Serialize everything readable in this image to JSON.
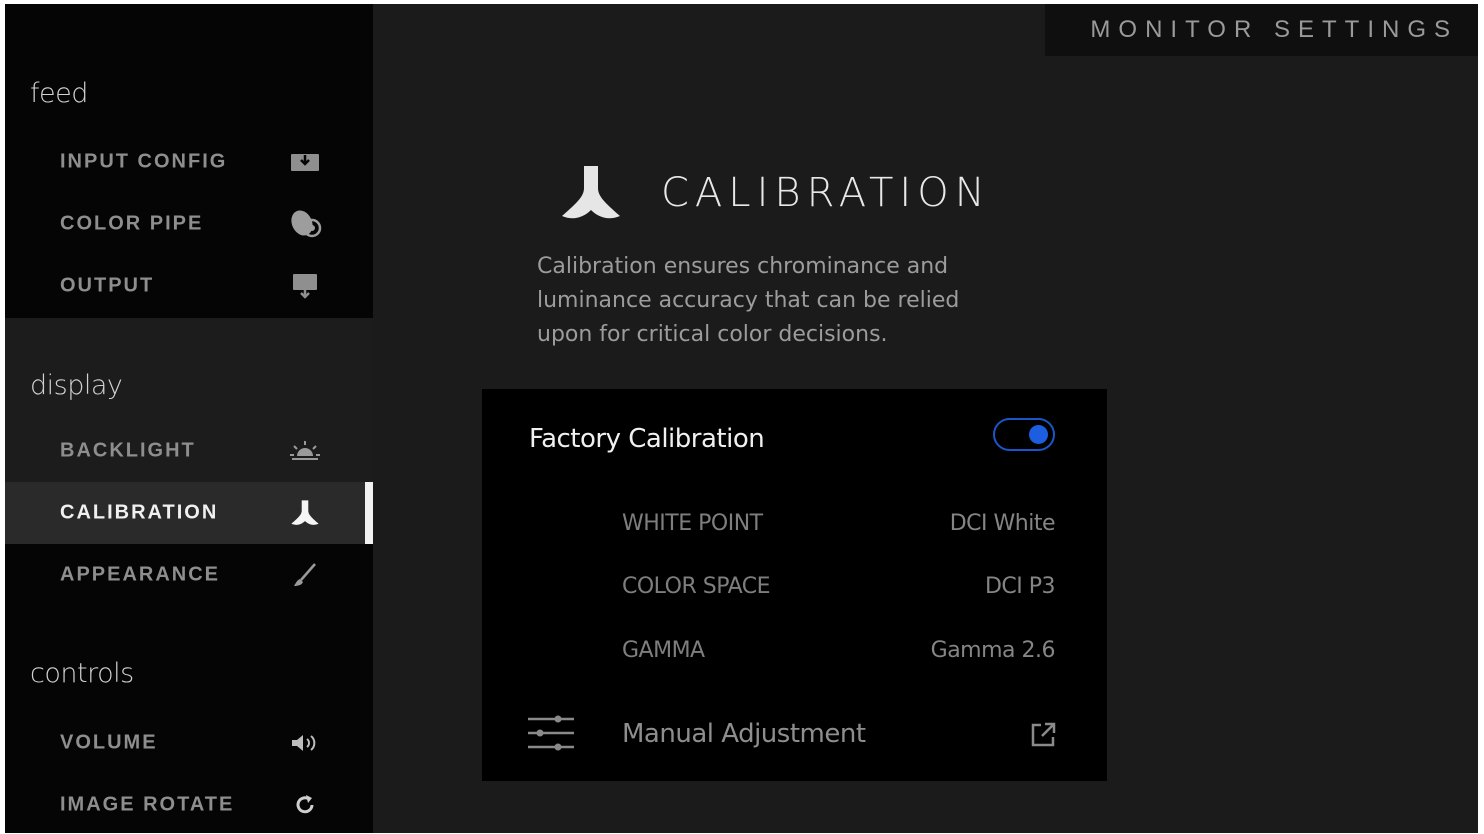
{
  "header": {
    "title": "MONITOR SETTINGS"
  },
  "sidebar": {
    "groups": [
      {
        "label": "feed",
        "items": [
          {
            "label": "INPUT CONFIG",
            "icon": "input-icon"
          },
          {
            "label": "COLOR PIPE",
            "icon": "color-pipe-icon"
          },
          {
            "label": "OUTPUT",
            "icon": "output-icon"
          }
        ]
      },
      {
        "label": "display",
        "items": [
          {
            "label": "BACKLIGHT",
            "icon": "backlight-icon"
          },
          {
            "label": "CALIBRATION",
            "icon": "calibration-icon",
            "active": true
          },
          {
            "label": "APPEARANCE",
            "icon": "brush-icon"
          }
        ]
      },
      {
        "label": "controls",
        "items": [
          {
            "label": "VOLUME",
            "icon": "volume-icon"
          },
          {
            "label": "IMAGE ROTATE",
            "icon": "rotate-icon"
          }
        ]
      }
    ]
  },
  "main": {
    "title": "CALIBRATION",
    "description": "Calibration ensures chrominance and luminance accuracy that can be relied upon for critical color decisions.",
    "panel": {
      "factory_calibration_label": "Factory Calibration",
      "factory_calibration_on": true,
      "rows": [
        {
          "label": "WHITE POINT",
          "value": "DCI White"
        },
        {
          "label": "COLOR SPACE",
          "value": "DCI P3"
        },
        {
          "label": "GAMMA",
          "value": "Gamma 2.6"
        }
      ],
      "manual_adjustment_label": "Manual Adjustment"
    }
  },
  "colors": {
    "accent": "#1d5ee0",
    "background": "#1b1b1b",
    "panel": "#000000"
  }
}
